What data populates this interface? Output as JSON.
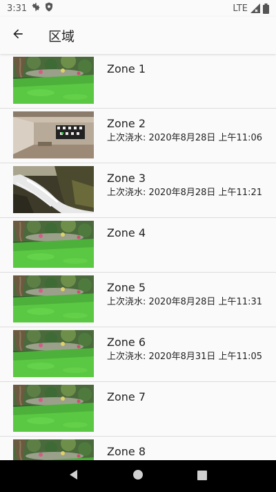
{
  "status_bar": {
    "time": "3:31",
    "network": "LTE",
    "icons": [
      "settings-icon",
      "shield-icon",
      "signal-icon",
      "battery-icon"
    ]
  },
  "app_bar": {
    "title": "区域",
    "back_icon": "arrow-back-icon"
  },
  "zones": [
    {
      "name": "Zone 1",
      "last_watered": "",
      "image": "lawn"
    },
    {
      "name": "Zone 2",
      "last_watered": "上次浇水: 2020年8月28日 上午11:06",
      "image": "room"
    },
    {
      "name": "Zone 3",
      "last_watered": "上次浇水: 2020年8月28日 上午11:21",
      "image": "waterfall"
    },
    {
      "name": "Zone 4",
      "last_watered": "",
      "image": "lawn"
    },
    {
      "name": "Zone 5",
      "last_watered": "上次浇水: 2020年8月28日 上午11:31",
      "image": "lawn"
    },
    {
      "name": "Zone 6",
      "last_watered": "上次浇水: 2020年8月31日 上午11:05",
      "image": "lawn"
    },
    {
      "name": "Zone 7",
      "last_watered": "",
      "image": "lawn"
    },
    {
      "name": "Zone 8",
      "last_watered": "",
      "image": "lawn"
    }
  ],
  "nav_bar": {
    "buttons": [
      "back-triangle-icon",
      "home-circle-icon",
      "recents-square-icon"
    ]
  },
  "colors": {
    "background": "#fafafa",
    "divider": "#dcdcdc",
    "nav_bar": "#000000",
    "text": "#222222"
  }
}
